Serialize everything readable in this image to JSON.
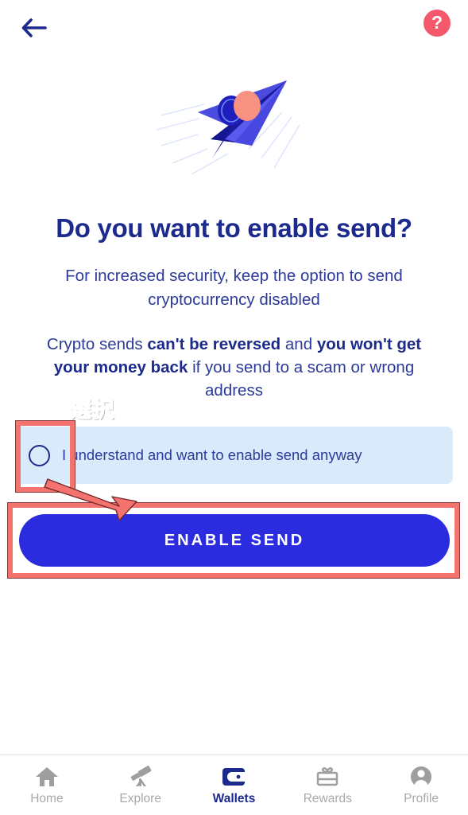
{
  "header": {
    "back_icon": "back-arrow-icon",
    "help_icon": "help-question-icon",
    "help_label": "?"
  },
  "hero": {
    "illustration": "paper-plane-with-coin-illustration"
  },
  "content": {
    "headline": "Do you want to enable send?",
    "subtitle": "For increased security, keep the option to send cryptocurrency disabled",
    "warning_parts": {
      "p1": "Crypto sends ",
      "b1": "can't be reversed",
      "p2": " and ",
      "b2": "you won't get your money back",
      "p3": " if you send to a scam or wrong address"
    }
  },
  "consent": {
    "label": "I understand and want to enable send anyway",
    "checked": false,
    "radio_icon": "radio-unchecked-icon"
  },
  "cta": {
    "label": "ENABLE SEND"
  },
  "annotations": {
    "select_text": "選択",
    "checkbox_highlight": "checkbox-highlight-box",
    "button_highlight": "button-highlight-box",
    "arrow": "pointer-arrow",
    "accent_color": "#f4736f"
  },
  "bottom_nav": {
    "items": [
      {
        "label": "Home",
        "icon": "home-icon",
        "active": false
      },
      {
        "label": "Explore",
        "icon": "telescope-icon",
        "active": false
      },
      {
        "label": "Wallets",
        "icon": "wallet-icon",
        "active": true
      },
      {
        "label": "Rewards",
        "icon": "gift-icon",
        "active": false
      },
      {
        "label": "Profile",
        "icon": "person-icon",
        "active": false
      }
    ]
  },
  "colors": {
    "navy": "#1b2a8c",
    "button_blue": "#2b2be0",
    "consent_bg": "#d9eafb",
    "help_red": "#f4586a",
    "nav_inactive": "#a8a8a8"
  }
}
